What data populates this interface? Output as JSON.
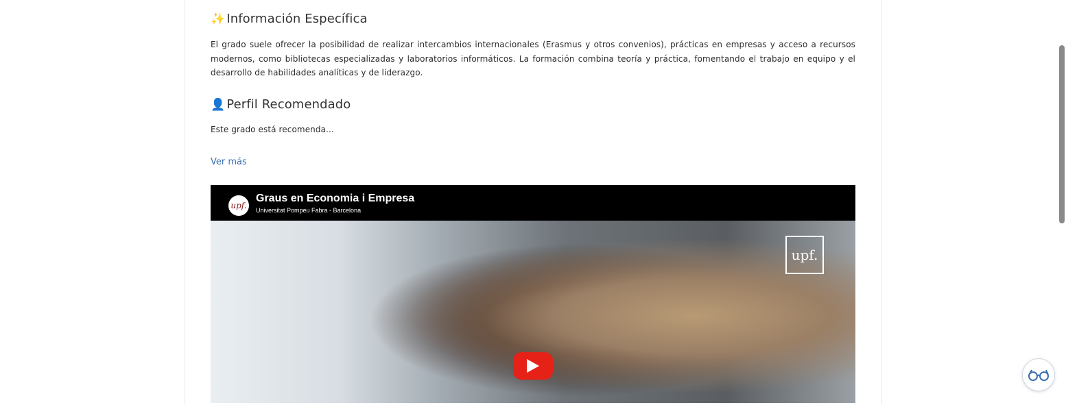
{
  "sections": [
    {
      "emoji": "✨",
      "title": "Información Específica",
      "text": "El grado suele ofrecer la posibilidad de realizar intercambios internacionales (Erasmus y otros convenios), prácticas en empresas y acceso a recursos modernos, como bibliotecas especializadas y laboratorios informáticos. La formación combina teoría y práctica, fomentando el trabajo en equipo y el desarrollo de habilidades analíticas y de liderazgo."
    },
    {
      "emoji": "👤",
      "title": "Perfil Recomendado",
      "text": "Este grado está recomenda..."
    }
  ],
  "see_more": "Ver más",
  "video": {
    "title": "Graus en Economia i Empresa",
    "subtitle": "Universitat Pompeu Fabra - Barcelona",
    "channel_logo_text": "upf.",
    "watermark_text": "upf.",
    "play_icon": "youtube-play-icon"
  },
  "reader_icon": "reading-glasses-icon",
  "colors": {
    "link": "#3a6fae",
    "play": "#e62117",
    "video_bar": "#000000"
  }
}
